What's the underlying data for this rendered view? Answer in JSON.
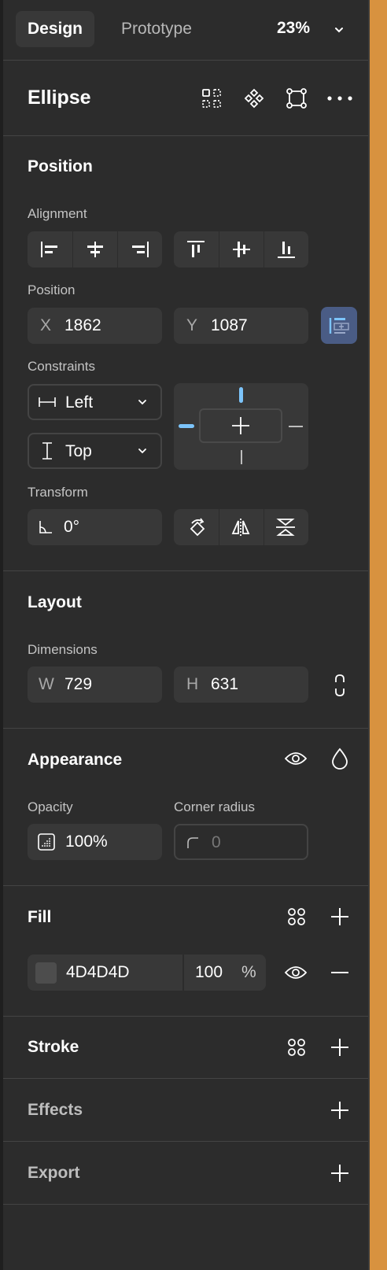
{
  "tabs": {
    "design": "Design",
    "prototype": "Prototype"
  },
  "zoom": "23%",
  "layer": {
    "title": "Ellipse"
  },
  "position_section": {
    "title": "Position",
    "alignment_label": "Alignment",
    "position_label": "Position",
    "x_prefix": "X",
    "x_value": "1862",
    "y_prefix": "Y",
    "y_value": "1087",
    "constraints_label": "Constraints",
    "horizontal_constraint": "Left",
    "vertical_constraint": "Top",
    "transform_label": "Transform",
    "rotation": "0°"
  },
  "layout_section": {
    "title": "Layout",
    "dimensions_label": "Dimensions",
    "w_prefix": "W",
    "w_value": "729",
    "h_prefix": "H",
    "h_value": "631"
  },
  "appearance_section": {
    "title": "Appearance",
    "opacity_label": "Opacity",
    "opacity_value": "100%",
    "corner_radius_label": "Corner radius",
    "corner_radius_value": "0"
  },
  "fill_section": {
    "title": "Fill",
    "hex": "4D4D4D",
    "opacity": "100",
    "percent": "%",
    "swatch_color": "#4d4d4d"
  },
  "stroke_section": {
    "title": "Stroke"
  },
  "effects_section": {
    "title": "Effects"
  },
  "export_section": {
    "title": "Export"
  },
  "colors": {
    "panel": "#2c2c2c",
    "accent": "#7cc4fa",
    "active_button": "#4a5c85",
    "edge": "#d8923f"
  }
}
